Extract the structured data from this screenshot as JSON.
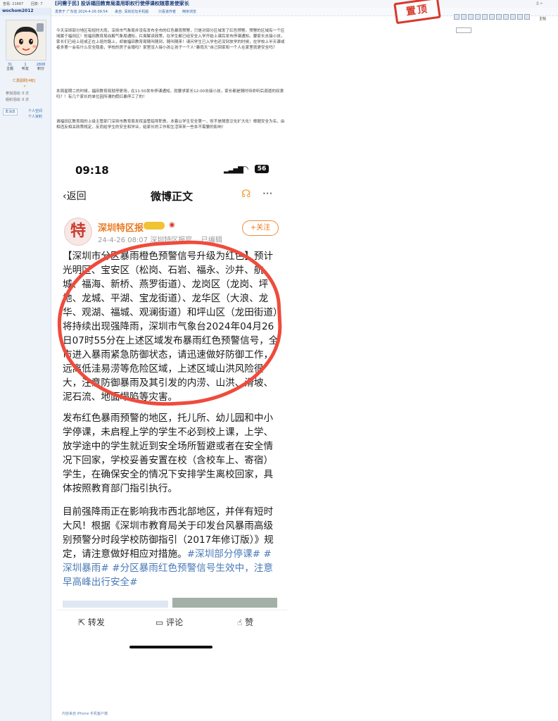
{
  "forum": {
    "topbar_views": "查看: 21667",
    "topbar_replies": "回复: 7",
    "thread_title": "[问需于民] 投诉福田教育局滥用职权行使停课权随意差使家长",
    "meta_author": "发表于 广东省",
    "meta_time": "2024-4-26 09:54",
    "meta_source": "来自: 深圳论坛手机版",
    "meta_only_author": "只看该作者",
    "meta_reverse": "倒序浏览",
    "stamp": "置顶",
    "floor_label": "主帖",
    "username": "wochom2012",
    "user_stats": [
      {
        "value": "31",
        "label": "主题"
      },
      {
        "value": "1",
        "label": "听友"
      },
      {
        "value": "2808",
        "label": "积分"
      }
    ],
    "user_rank": "仁勇副尉[4级]",
    "user_line1": "参加活动: 0 次",
    "user_line2": "组织活动: 0 次",
    "btn_pm": "发消息",
    "btn_space": "个人空间",
    "btn_profile": "个人资料",
    "para1": "今天深圳部分地区有短时大雨，深圳市气象局并没有发布全市的红色暴雨预警，只是对部分区域发了红色预警。预警的区域有一个区域属于福田区！但福田教育局血解气象局通知，片面解读政策，在学生都已经安全入学开始上课后发布停课通知。要家长去接小孩，家长们已经上班或正在上班的路上，却被福田教育局随叫随到，随叫随来！请问学生已入学也还没到放学的时候，在学校上半天课或者多第一会有什么安全隐患，学校的房子会塌吗？家里没人接小孩让孩子一个人“暴雨天”自己回家和一个人在家里就更安全吗？",
    "para2": "本周星期二的时候，福田教育局就停更场，在11:50发布停课通知，就要求家长12:00去接小孩，家长都是随时待命听后调遣的奴隶吗？！有几个家长的单位因所谓的假红暴停工了的！",
    "para3": "请福田区教育局的上级主管部门深圳市教育局发挥监管指导职责，本着以学生安全第一，但不是随意泛化扩大化！根据安全为名，由相违反相关政策规定，反而给学生的安全和学业，给家长的工作和生活带来一些本不需要的影响！",
    "footer_link": "内容来自 iPhone 手机客户端"
  },
  "screenshot": {
    "time": "09:18",
    "battery": "56",
    "nav_back": "返回",
    "nav_title": "微博正文",
    "account_name": "深圳特区报",
    "account_avatar_text": "特",
    "account_meta": "24-4-26 08:07  深圳特区报官...  已编辑",
    "follow": "+关注",
    "post_para1": "【深圳市分区暴雨橙色预警信号升级为红色】预计光明区、宝安区（松岗、石岩、福永、沙井、航城、福海、新桥、燕罗街道）、龙岗区（龙岗、坪地、龙城、平湖、宝龙街道）、龙华区（大浪、龙华、观湖、福城、观澜街道）和坪山区（龙田街道）将持续出现强降雨，深圳市气象台2024年04月26日07时55分在上述区域发布暴雨红色预警信号，全市进入暴雨紧急防御状态，请迅速做好防御工作，远离低洼易涝等危险区域，上述区域山洪风险很大，注意防御暴雨及其引发的内涝、山洪、滑坡、泥石流、地面塌陷等灾害。",
    "post_para2": "发布红色暴雨预警的地区，托儿所、幼儿园和中小学停课，未启程上学的学生不必到校上课，上学、放学途中的学生就近到安全场所暂避或者在安全情况下回家，学校妥善安置在校（含校车上、寄宿）学生，在确保安全的情况下安排学生离校回家，具体按照教育部门指引执行。",
    "post_para3_text": "目前强降雨正在影响我市西北部地区，并伴有短时大风！根据《深圳市教育局关于印发台风暴雨高级别预警分时段学校防御指引（2017年修订版）》规定，请注意做好相应对措施。",
    "post_tags": "#深圳部分停课# #深圳暴雨# #分区暴雨红色预警信号生效中，注意早高峰出行安全#",
    "action_repost": "转发",
    "action_comment": "评论",
    "action_like": "赞"
  },
  "colors": {
    "forum_link": "#3366aa",
    "title": "#1a3c7a",
    "weibo_orange": "#ea7b22",
    "circle_red": "#ef4b3c",
    "tag_blue": "#4a7ab8"
  }
}
